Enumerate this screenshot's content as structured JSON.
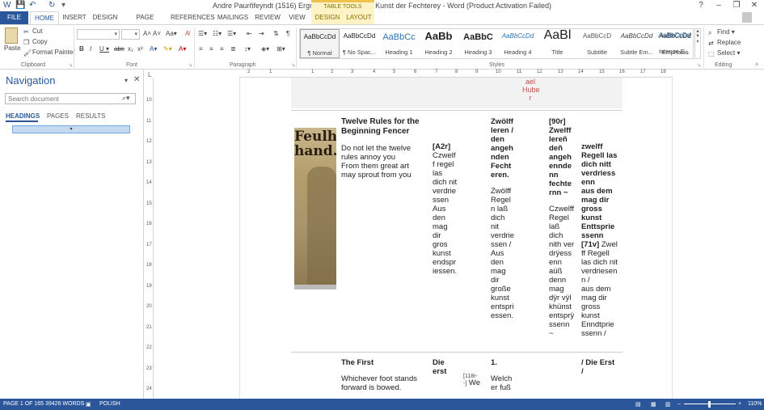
{
  "window": {
    "title": "Andre Paurñfeyndt (1516) Ergrundung Ritterlicher Kunst der Fechterey - Word (Product Activation Failed)",
    "minimize": "–",
    "restore": "❐",
    "close": "✕",
    "help": "?"
  },
  "qat": {
    "save": "💾",
    "undo": "↶",
    "redo": "↻",
    "customize": "▾"
  },
  "contextual": {
    "group_label": "TABLE TOOLS"
  },
  "tabs": [
    "FILE",
    "HOME",
    "INSERT",
    "DESIGN",
    "PAGE LAYOUT",
    "REFERENCES",
    "MAILINGS",
    "REVIEW",
    "VIEW",
    "DESIGN",
    "LAYOUT"
  ],
  "user": {
    "name": ""
  },
  "ribbon": {
    "clipboard": {
      "label": "Clipboard",
      "paste": "Paste",
      "cut": "Cut",
      "copy": "Copy",
      "format_painter": "Format Painter"
    },
    "font": {
      "label": "Font",
      "font_name": "",
      "font_size": ""
    },
    "paragraph": {
      "label": "Paragraph"
    },
    "styles": {
      "label": "Styles",
      "items": [
        {
          "preview": "AaBbCcDd",
          "name": "¶ Normal"
        },
        {
          "preview": "AaBbCcDd",
          "name": "¶ No Spac..."
        },
        {
          "preview": "AaBbCc",
          "name": "Heading 1"
        },
        {
          "preview": "AaBb",
          "name": "Heading 2"
        },
        {
          "preview": "AaBbC",
          "name": "Heading 3"
        },
        {
          "preview": "AaBbCcDd",
          "name": "Heading 4"
        },
        {
          "preview": "AaBl",
          "name": "Title"
        },
        {
          "preview": "AaBbCcD",
          "name": "Subtitle"
        },
        {
          "preview": "AaBbCcDd",
          "name": "Subtle Em..."
        },
        {
          "preview": "AaBbCcDd",
          "name": "Emphasis"
        },
        {
          "preview": "AaBbCcDd",
          "name": "Intense E..."
        }
      ]
    },
    "editing": {
      "label": "Editing",
      "find": "Find",
      "replace": "Replace",
      "select": "Select"
    }
  },
  "nav": {
    "title": "Navigation",
    "search_placeholder": "Search document",
    "tabs": [
      "HEADINGS",
      "PAGES",
      "RESULTS"
    ],
    "heading_marker": "▾"
  },
  "ruler": {
    "h": [
      "2",
      "1",
      "1",
      "2",
      "3",
      "4",
      "5",
      "6",
      "7",
      "8",
      "9",
      "10",
      "11",
      "12",
      "13",
      "14",
      "15",
      "16",
      "17",
      "18"
    ],
    "v": [
      "10",
      "11",
      "12",
      "13",
      "14",
      "15",
      "16",
      "17",
      "18",
      "19",
      "20",
      "21",
      "22",
      "23",
      "24"
    ]
  },
  "document": {
    "top_row_text": "ael\nHube\nr",
    "row1": {
      "c1_title": "Twelve Rules for the Beginning Fencer",
      "c1_body": "Do not let the twelve rules annoy you\nFrom them great art may sprout from you",
      "c2_ref": "[A2r]",
      "c2_body": "Czwelf\nf regel\nlas\ndich nit\nverdrie\nssen\nAus\nden\nmag\ndir\ngros\nkunst\nendspr\niessen.",
      "c3_title": "Zwölff\nleren /\nden\nangeh\nnden\nFecht\neren.",
      "c3_body": "Zwölff\nRegel\nn laß\ndich\nnit\nverdrie\nssen /\nAus\nden\nmag\ndir\ngroße\nkunst\nentspri\nessen.",
      "c4_title": "[90r]\nZwelff\nlereñ\ndeñ\nangeh\nennde\nnn\nfechte\nrnn ~",
      "c4_body": "Czwelff\nRegel\nlaß\ndich\nnith ver\ndrÿess\nenn\naüß\ndenn\nmag\ndÿr vÿl\nkhünst\nentsprÿ\nssenn\n~",
      "c5_title": "zwelff\nRegell las\ndich nitt\nverdriess\nenn\naus dem\nmag dir\ngross\nkunst\nEnttsprie\nssenn",
      "c5_ref": "[71v]",
      "c5_body": " Zwel\nff Regell\nlas dich nit\nverdriesen\nn /\naus dem\nmag dir\ngross\nkunst\nEnndtprie\nssenn /"
    },
    "row2": {
      "c1_title": "The First",
      "c1_body": "Whichever foot stands forward is bowed.",
      "c2_title": "Die\nerst",
      "c2_ref": "[118r-\n-]",
      "c2_body": " We",
      "c3_title": "1.",
      "c3_body": "Welch\ner fuß",
      "c5_title": "/ Die Erst\n/"
    },
    "manuscript_text": "Feulh\nhand."
  },
  "status": {
    "page": "PAGE 1 OF 165",
    "words": "39426 WORDS",
    "language": "POLISH",
    "zoom": "110%",
    "zoom_fraction": 0.48
  }
}
